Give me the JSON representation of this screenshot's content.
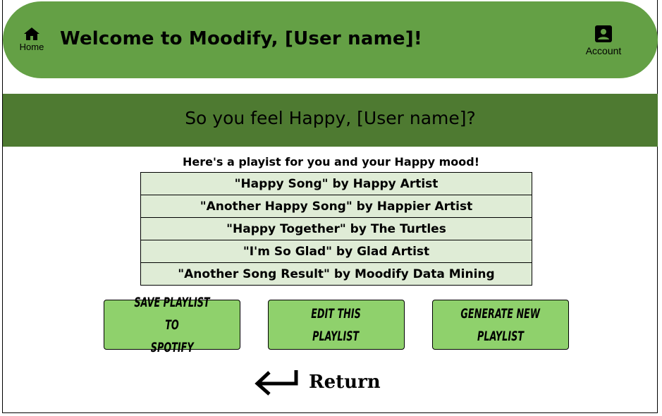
{
  "header": {
    "home_label": "Home",
    "welcome_text": "Welcome to Moodify, [User name]!",
    "account_label": "Account",
    "background_color": "#64a045"
  },
  "mood_band": {
    "text": "So you feel Happy, [User name]?",
    "background_color": "#4e7a31"
  },
  "playlist": {
    "intro": "Here's a playist for you and your Happy mood!",
    "songs": [
      "\"Happy Song\" by Happy Artist",
      "\"Another Happy Song\" by Happier Artist",
      "\"Happy Together\" by The Turtles",
      "\"I'm So Glad\" by Glad Artist",
      "\"Another Song Result\" by Moodify Data Mining"
    ],
    "row_color": "#dfecd6"
  },
  "actions": {
    "save_label_1": "SAVE PLAYLIST TO",
    "save_label_2": "SPOTIFY",
    "edit_label_1": "EDIT THIS",
    "edit_label_2": "PLAYLIST",
    "generate_label_1": "GENERATE NEW",
    "generate_label_2": "PLAYLIST",
    "button_color": "#8fd16c"
  },
  "return_label": "Return",
  "icons": {
    "home": "home-icon",
    "account": "account-icon",
    "return": "return-arrow-icon"
  }
}
